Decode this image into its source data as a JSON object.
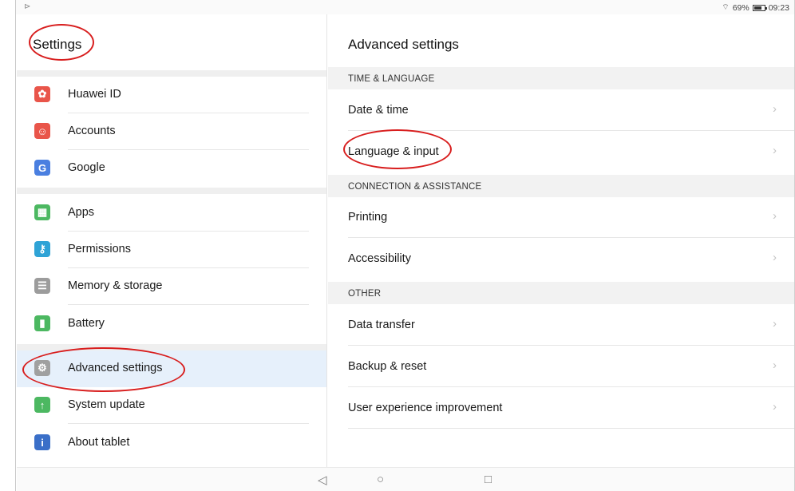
{
  "status_bar": {
    "left_icon": "play-icon",
    "wifi_icon": "wifi-icon",
    "battery_percent": "69%",
    "battery_icon": "battery-icon",
    "time": "09:23"
  },
  "left_pane": {
    "title": "Settings",
    "items": [
      {
        "label": "Huawei ID",
        "icon": "huawei-icon",
        "glyph": "✿",
        "color": "#e9554a"
      },
      {
        "label": "Accounts",
        "icon": "accounts-icon",
        "glyph": "☺",
        "color": "#e9554a"
      },
      {
        "label": "Google",
        "icon": "google-icon",
        "glyph": "G",
        "color": "#4a7fe0"
      },
      {
        "label": "Apps",
        "icon": "apps-icon",
        "glyph": "▦",
        "color": "#4cb861"
      },
      {
        "label": "Permissions",
        "icon": "key-icon",
        "glyph": "⚷",
        "color": "#2fa3d6"
      },
      {
        "label": "Memory & storage",
        "icon": "storage-icon",
        "glyph": "☰",
        "color": "#9c9c9c"
      },
      {
        "label": "Battery",
        "icon": "battery-settings-icon",
        "glyph": "▮",
        "color": "#4cb861"
      },
      {
        "label": "Advanced settings",
        "icon": "gear-icon",
        "glyph": "⚙",
        "color": "#a0a0a0"
      },
      {
        "label": "System update",
        "icon": "system-update-icon",
        "glyph": "↑",
        "color": "#4cb861"
      },
      {
        "label": "About tablet",
        "icon": "info-icon",
        "glyph": "i",
        "color": "#3a6fc8"
      }
    ]
  },
  "right_pane": {
    "title": "Advanced settings",
    "sections": [
      {
        "header": "TIME & LANGUAGE",
        "rows": [
          "Date & time",
          "Language & input"
        ]
      },
      {
        "header": "CONNECTION & ASSISTANCE",
        "rows": [
          "Printing",
          "Accessibility"
        ]
      },
      {
        "header": "OTHER",
        "rows": [
          "Data transfer",
          "Backup & reset",
          "User experience improvement"
        ]
      }
    ],
    "chevron": "›"
  },
  "nav_bar": {
    "back": "◁",
    "home": "○",
    "recents": "□"
  },
  "colors": {
    "selected_bg": "#e6f0fb",
    "annotation_red": "#d81e1e"
  }
}
